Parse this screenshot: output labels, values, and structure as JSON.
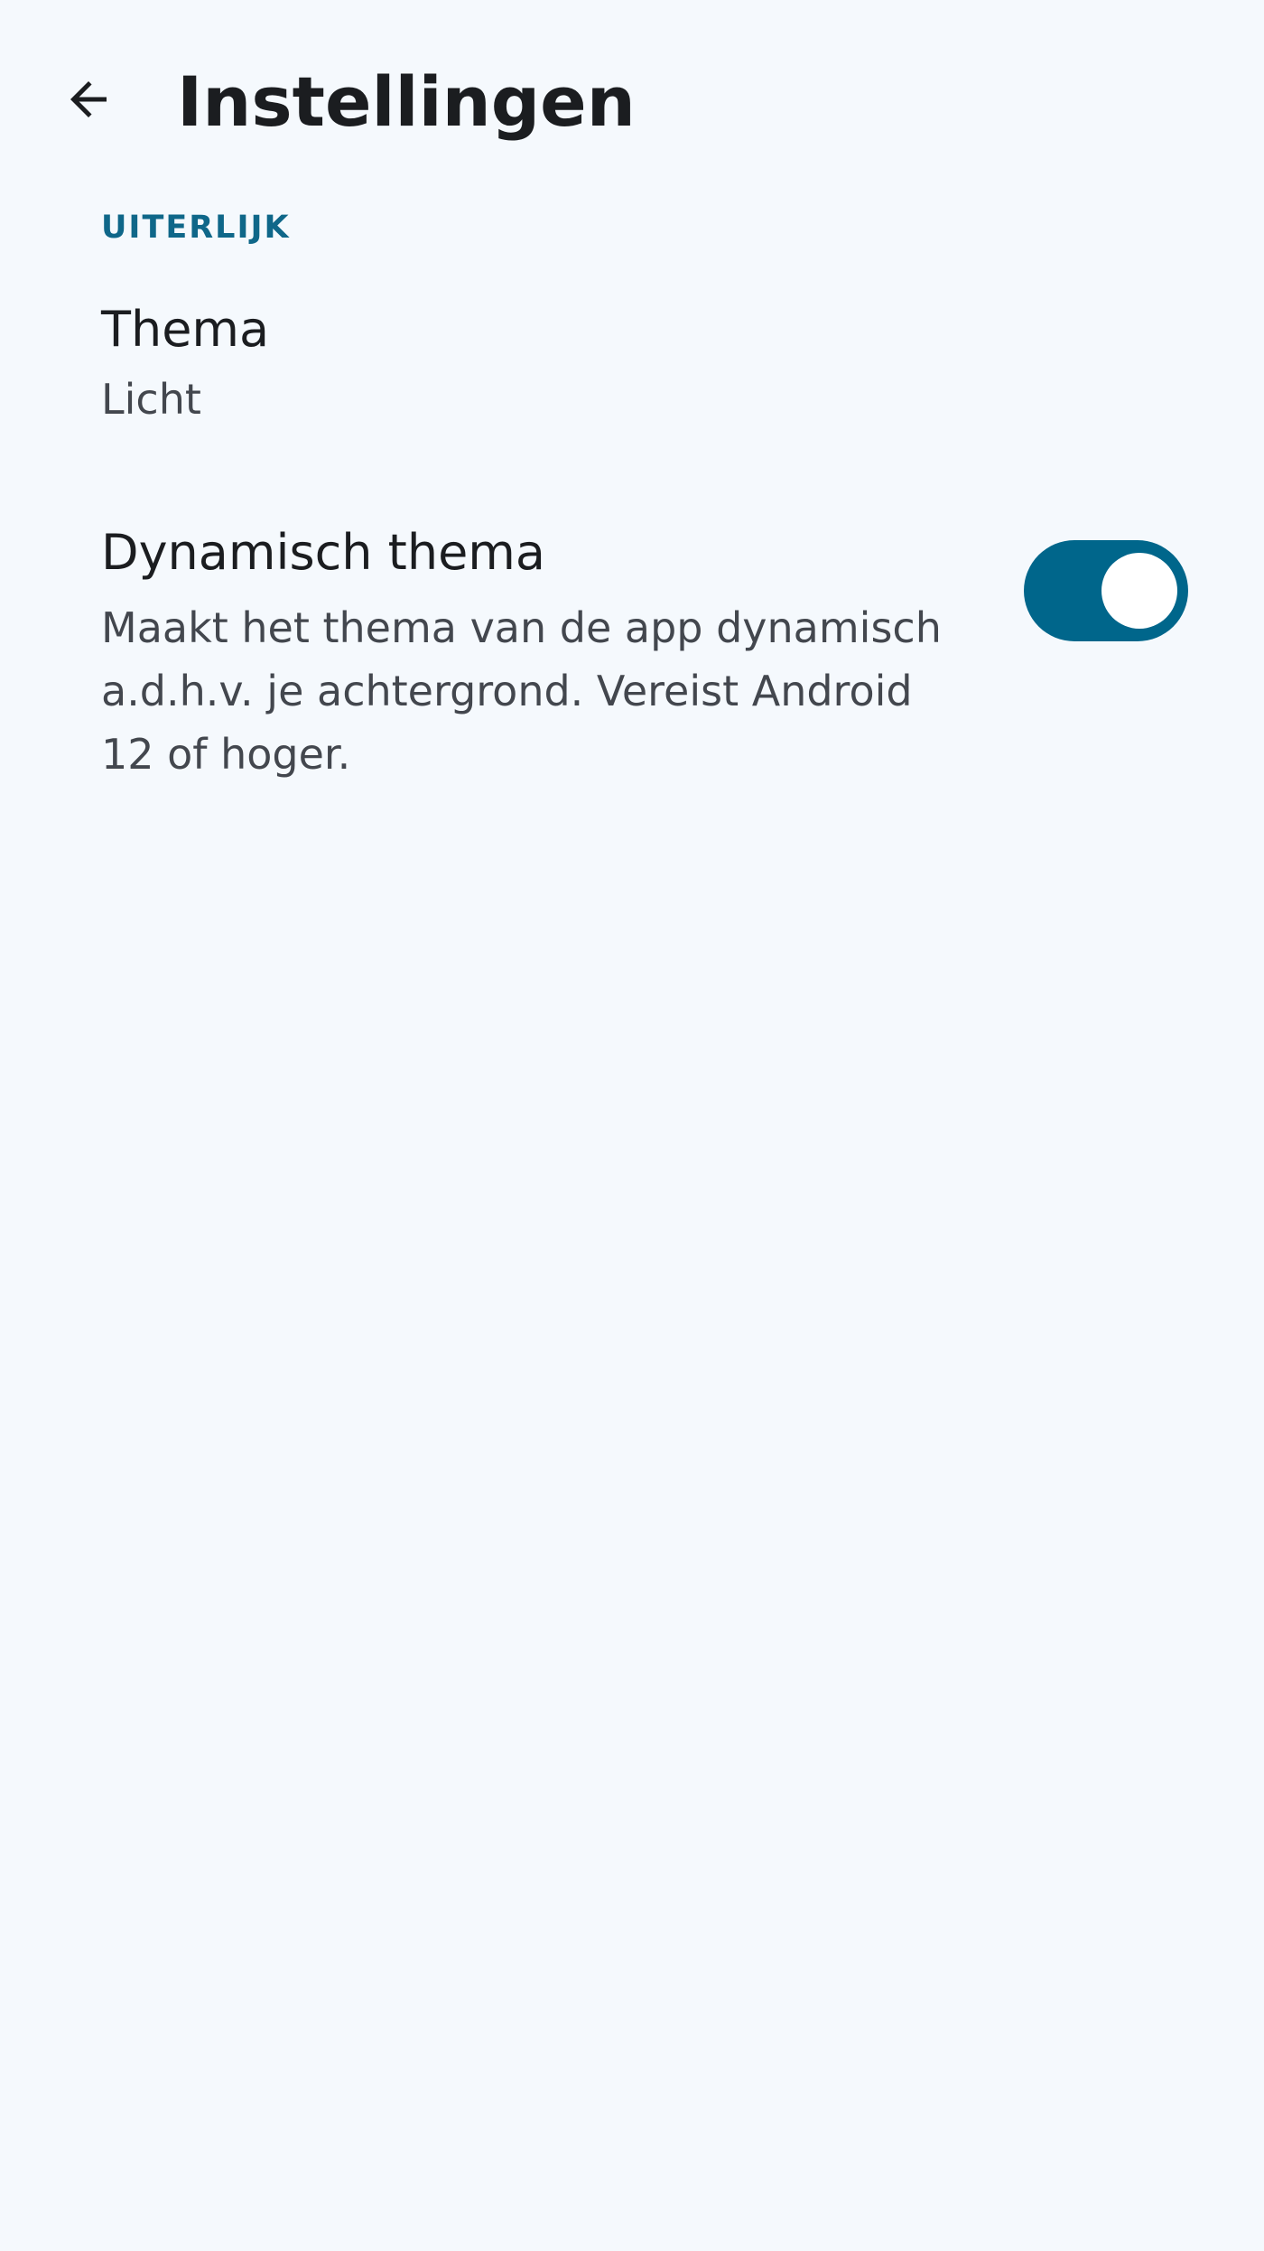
{
  "header": {
    "back_icon": "arrow-back-icon",
    "title": "Instellingen"
  },
  "sections": [
    {
      "header": "UITERLIJK",
      "preferences": [
        {
          "title": "Thema",
          "summary": "Licht"
        },
        {
          "title": "Dynamisch thema",
          "summary": "Maakt het thema van de app dynamisch a.d.h.v. je achtergrond. Vereist Android 12 of hoger.",
          "switch_on": true
        }
      ]
    }
  ],
  "colors": {
    "background": "#f5f9fd",
    "accent": "#00668b",
    "section_header": "#0f6789",
    "title_text": "#1b1d20",
    "summary_text": "#43474e"
  }
}
